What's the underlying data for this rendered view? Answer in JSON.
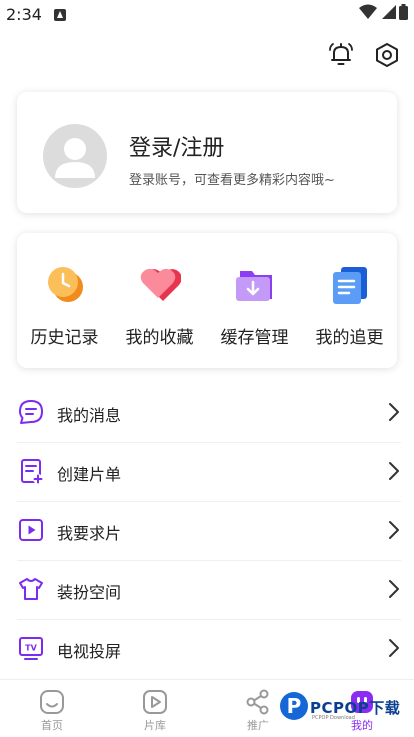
{
  "status_bar": {
    "time": "2:34"
  },
  "profile": {
    "title": "登录/注册",
    "subtitle": "登录账号，可查看更多精彩内容哦~"
  },
  "quick_actions": [
    {
      "label": "历史记录",
      "icon": "history-clock-icon"
    },
    {
      "label": "我的收藏",
      "icon": "heart-icon"
    },
    {
      "label": "缓存管理",
      "icon": "download-folder-icon"
    },
    {
      "label": "我的追更",
      "icon": "document-list-icon"
    }
  ],
  "menu": [
    {
      "label": "我的消息",
      "icon": "message-icon"
    },
    {
      "label": "创建片单",
      "icon": "create-list-icon"
    },
    {
      "label": "我要求片",
      "icon": "play-request-icon"
    },
    {
      "label": "装扮空间",
      "icon": "tshirt-icon"
    },
    {
      "label": "电视投屏",
      "icon": "tv-cast-icon"
    }
  ],
  "tabs": [
    {
      "label": "首页",
      "icon": "home-icon"
    },
    {
      "label": "片库",
      "icon": "video-library-icon"
    },
    {
      "label": "推广",
      "icon": "share-icon"
    },
    {
      "label": "我的",
      "icon": "profile-icon",
      "active": true
    }
  ],
  "watermark": {
    "badge": "P",
    "text": "PCPOP下载",
    "small": "PCPOP Download"
  },
  "colors": {
    "accent": "#8b2cf5",
    "icon_tint": "#7b2cf0"
  }
}
